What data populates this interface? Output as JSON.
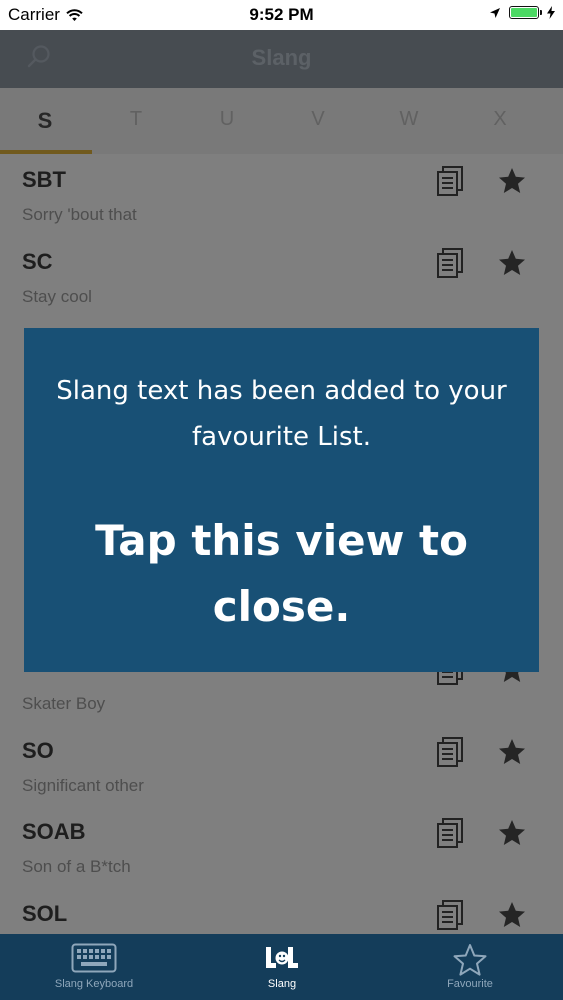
{
  "status_bar": {
    "carrier": "Carrier",
    "time": "9:52 PM"
  },
  "nav": {
    "title": "Slang",
    "search_icon": "search-icon"
  },
  "letter_tabs": [
    "S",
    "T",
    "U",
    "V",
    "W",
    "X"
  ],
  "active_letter": "S",
  "rows": [
    {
      "abbr": "SBT",
      "meaning": "Sorry 'bout that"
    },
    {
      "abbr": "SC",
      "meaning": "Stay cool"
    },
    {
      "abbr": "",
      "meaning": ""
    },
    {
      "abbr": "",
      "meaning": ""
    },
    {
      "abbr": "",
      "meaning": ""
    },
    {
      "abbr": "",
      "meaning": ""
    },
    {
      "abbr": "",
      "meaning": "Skater Boy"
    },
    {
      "abbr": "SO",
      "meaning": "Significant other"
    },
    {
      "abbr": "SOAB",
      "meaning": "Son of a B*tch"
    },
    {
      "abbr": "SOL",
      "meaning": ""
    }
  ],
  "popup": {
    "message": "Slang text has been added to your favourite List.",
    "close_text": "Tap this view to close."
  },
  "tab_bar": {
    "items": [
      {
        "label": "Slang Keyboard",
        "icon": "keyboard-icon"
      },
      {
        "label": "Slang",
        "icon": "lol-icon"
      },
      {
        "label": "Favourite",
        "icon": "star-outline-icon"
      }
    ],
    "active_index": 1
  },
  "colors": {
    "nav_bg": "#8e98a3",
    "popup_bg": "#185075",
    "tab_bar_bg": "#143d5a",
    "tab_underline": "#e3b53c",
    "battery": "#4cd964"
  }
}
